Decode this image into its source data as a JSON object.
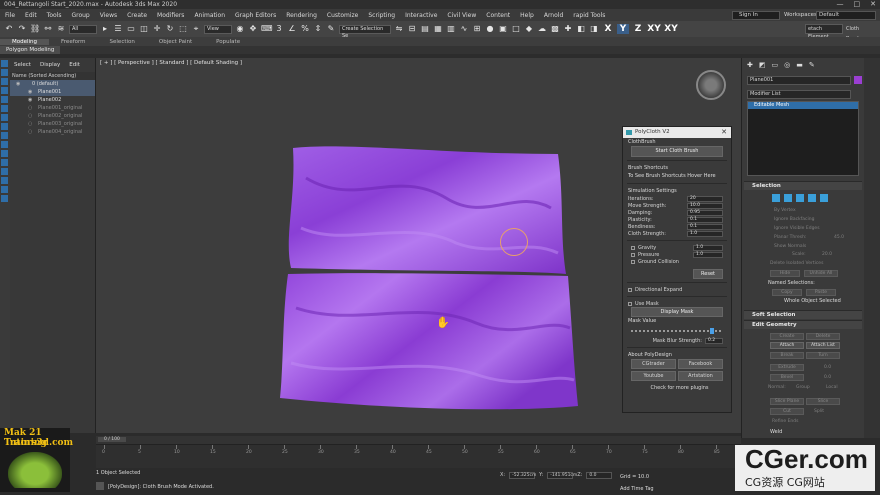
{
  "window": {
    "title": "004_Rettangoli Start_2020.max - Autodesk 3ds Max 2020",
    "controls": [
      "—",
      "□",
      "✕"
    ]
  },
  "menu": [
    "File",
    "Edit",
    "Tools",
    "Group",
    "Views",
    "Create",
    "Modifiers",
    "Animation",
    "Graph Editors",
    "Rendering",
    "Customize",
    "Scripting",
    "Interactive",
    "Civil View",
    "Content",
    "Help",
    "Arnold",
    "rapid Tools"
  ],
  "account": {
    "signin": "Sign In",
    "workspaces_label": "Workspaces:",
    "workspace": "Default"
  },
  "toolbar": {
    "selection_filter": "All",
    "view_dropdown": "View",
    "selection_set": "Create Selection Se",
    "axes": [
      "X",
      "Y",
      "Z",
      "XY",
      "XY"
    ],
    "edit_element": "etach Element",
    "cloth_brushes": "Cloth Brushes"
  },
  "ribbon": {
    "tabs": [
      "Modeling",
      "Freeform",
      "Selection",
      "Object Paint",
      "Populate"
    ],
    "active": "Modeling",
    "polymodeling": "Polygon Modeling"
  },
  "explorer": {
    "tabs": [
      "Select",
      "Display",
      "Edit"
    ],
    "header": "Name (Sorted Ascending)",
    "items": [
      {
        "label": "0 (default)",
        "selected": true,
        "dim": false
      },
      {
        "label": "Plane001",
        "selected": true,
        "dim": false
      },
      {
        "label": "Plane002",
        "selected": false,
        "dim": false
      },
      {
        "label": "Plane001_original",
        "selected": false,
        "dim": true
      },
      {
        "label": "Plane002_original",
        "selected": false,
        "dim": true
      },
      {
        "label": "Plane003_original",
        "selected": false,
        "dim": true
      },
      {
        "label": "Plane004_original",
        "selected": false,
        "dim": true
      }
    ]
  },
  "viewport": {
    "label": "[ + ] [ Perspective ] [ Standard ] [ Default Shading ]",
    "cloth_color": "#9a4fe0"
  },
  "polycloth": {
    "title": "PolyCloth V2",
    "section_clothbrush": "ClothBrush",
    "start_button": "Start Cloth Brush",
    "shortcuts_title": "Brush Shortcuts",
    "shortcuts_hint": "To See Brush Shortcuts Hover Here",
    "sim_settings": "Simulation Settings",
    "params": [
      {
        "label": "Iterations:",
        "value": "20"
      },
      {
        "label": "Move Strength:",
        "value": "10.0"
      },
      {
        "label": "Damping:",
        "value": "0.95"
      },
      {
        "label": "Plasticity:",
        "value": "0.1"
      },
      {
        "label": "Bendiness:",
        "value": "0.1"
      },
      {
        "label": "Cloth Strength:",
        "value": "1.0"
      }
    ],
    "checks": [
      {
        "label": "Gravity",
        "value": "1.0"
      },
      {
        "label": "Pressure",
        "value": "1.0"
      },
      {
        "label": "Ground Collision",
        "value": ""
      }
    ],
    "reset": "Reset",
    "directional_expand": "Directional Expand",
    "use_mask": "Use Mask",
    "display_mask": "Display Mask",
    "mask_value": "Mask Value",
    "mask_slider": 0.9,
    "mask_blur_label": "Mask Blur Strength:",
    "mask_blur_value": "0.2",
    "about": "About PolyDesign",
    "links": [
      "CGtrader",
      "Facebook",
      "Youtube",
      "Artstation"
    ],
    "more": "Check for more plugins"
  },
  "command": {
    "object_name": "Plane001",
    "object_color": "#9b3fd3",
    "modifier_list": "Modifier List",
    "stack_item": "Editable Mesh",
    "selection": "Selection",
    "faint": [
      "By Vertex",
      "Ignore Backfacing",
      "Ignore Visible Edges",
      "Planar Thresh:",
      "45.0",
      "Show Normals",
      "Scale:",
      "20.0",
      "Delete Isolated Vertices",
      "Hide",
      "Unhide All",
      "Copy",
      "Paste",
      "Create",
      "Delete",
      "Break",
      "Turn",
      "Extrude",
      "0.0",
      "Bevel",
      "0.0",
      "Normal:",
      "Group",
      "Local",
      "Slice Plane",
      "Slice",
      "Cut",
      "Split",
      "Refine Ends",
      "Weld"
    ],
    "named_selections": "Named Selections:",
    "whole_object": "Whole Object Selected",
    "soft_selection": "Soft Selection",
    "edit_geometry": "Edit Geometry",
    "attach": "Attach",
    "attach_list": "Attach List"
  },
  "timeline": {
    "frame": "0 / 100",
    "ticks": [
      "0",
      "5",
      "10",
      "15",
      "20",
      "25",
      "30",
      "35",
      "40",
      "45",
      "50",
      "55",
      "60",
      "65",
      "70",
      "75",
      "80",
      "85"
    ]
  },
  "status": {
    "selected": "1 Object Selected",
    "message": "[PolyDesign]: Cloth Brush Mode Activated.",
    "x_label": "X:",
    "x": "-52.325cm",
    "y_label": "Y:",
    "y": "-141.951cm",
    "z_label": "Z:",
    "z": "0.0",
    "grid": "Grid = 10.0",
    "add_time_tag": "Add Time Tag"
  },
  "logos": {
    "train1": "Mak 21 Training",
    "train2": "Tutors3d.com",
    "cger": "CGer.com",
    "cger_sub": "CG资源 CG网站"
  }
}
